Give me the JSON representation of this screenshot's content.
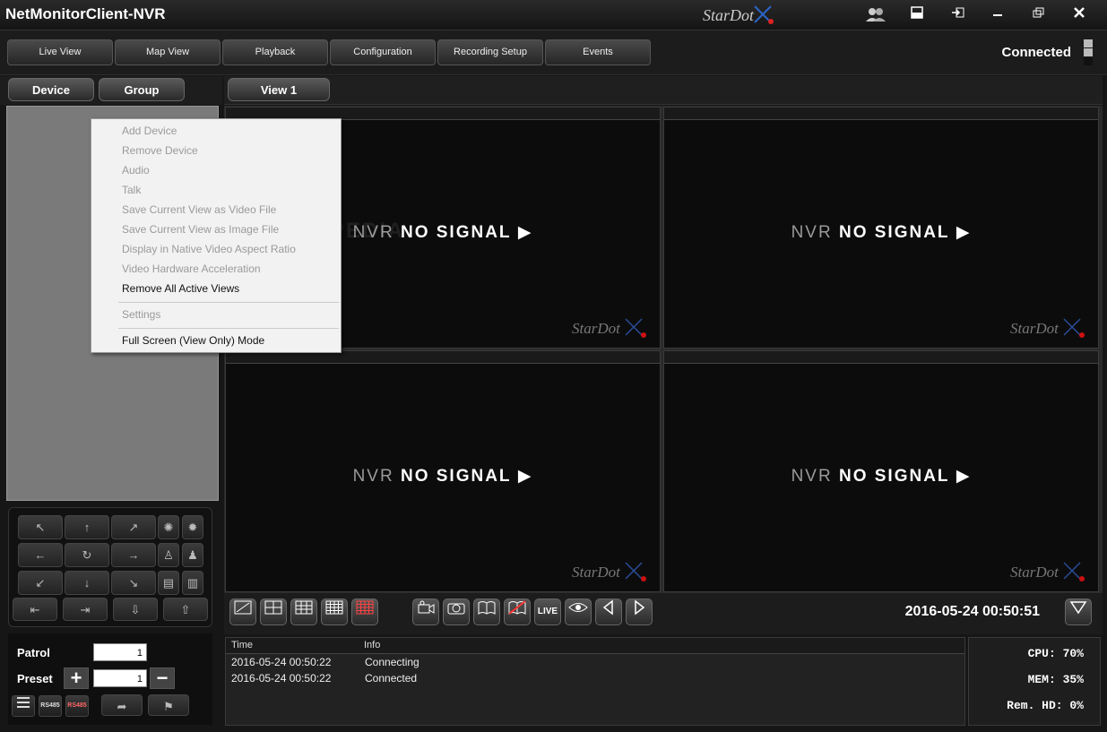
{
  "window": {
    "title": "NetMonitorClient-NVR",
    "brand": "StarDot",
    "controls": [
      "users-icon",
      "layout-icon",
      "logout-icon",
      "minimize-icon",
      "restore-icon",
      "close-icon"
    ]
  },
  "tabs": [
    "Live View",
    "Map View",
    "Playback",
    "Configuration",
    "Recording Setup",
    "Events"
  ],
  "status": {
    "label": "Connected"
  },
  "left_tabs": {
    "device": "Device",
    "group": "Group"
  },
  "view_tab": "View 1",
  "context_menu": {
    "items": [
      {
        "label": "Add Device",
        "enabled": false
      },
      {
        "label": "Remove Device",
        "enabled": false
      },
      {
        "label": "Audio",
        "enabled": false
      },
      {
        "label": "Talk",
        "enabled": false
      },
      {
        "label": "Save Current View as Video File",
        "enabled": false
      },
      {
        "label": "Save Current View as Image File",
        "enabled": false
      },
      {
        "label": "Display in Native Video Aspect Ratio",
        "enabled": false
      },
      {
        "label": "Video Hardware Acceleration",
        "enabled": false
      },
      {
        "label": "Remove All Active Views",
        "enabled": true
      },
      {
        "label": "Settings",
        "enabled": false
      },
      {
        "label": "Full Screen (View Only) Mode",
        "enabled": true
      }
    ]
  },
  "cells": [
    {
      "prefix": "NVR",
      "text": "NO SIGNAL"
    },
    {
      "prefix": "NVR",
      "text": "NO SIGNAL"
    },
    {
      "prefix": "NVR",
      "text": "NO SIGNAL"
    },
    {
      "prefix": "NVR",
      "text": "NO SIGNAL"
    }
  ],
  "cell_logo": "StarDot",
  "watermark": "SOFTPEDIA",
  "toolbar": {
    "live_label": "LIVE",
    "clock": "2016-05-24 00:50:51"
  },
  "patrol": {
    "label": "Patrol",
    "value": "1"
  },
  "preset": {
    "label": "Preset",
    "value": "1",
    "plus": "+",
    "minus": "−"
  },
  "rs485_labels": [
    "RS485",
    "RS485"
  ],
  "log": {
    "headers": [
      "Time",
      "Info"
    ],
    "rows": [
      {
        "time": "2016-05-24 00:50:22",
        "info": "Connecting"
      },
      {
        "time": "2016-05-24 00:50:22",
        "info": "Connected"
      }
    ]
  },
  "stats": {
    "cpu": "CPU:  70%",
    "mem": "MEM:  35%",
    "hd": "Rem. HD:   0%"
  }
}
